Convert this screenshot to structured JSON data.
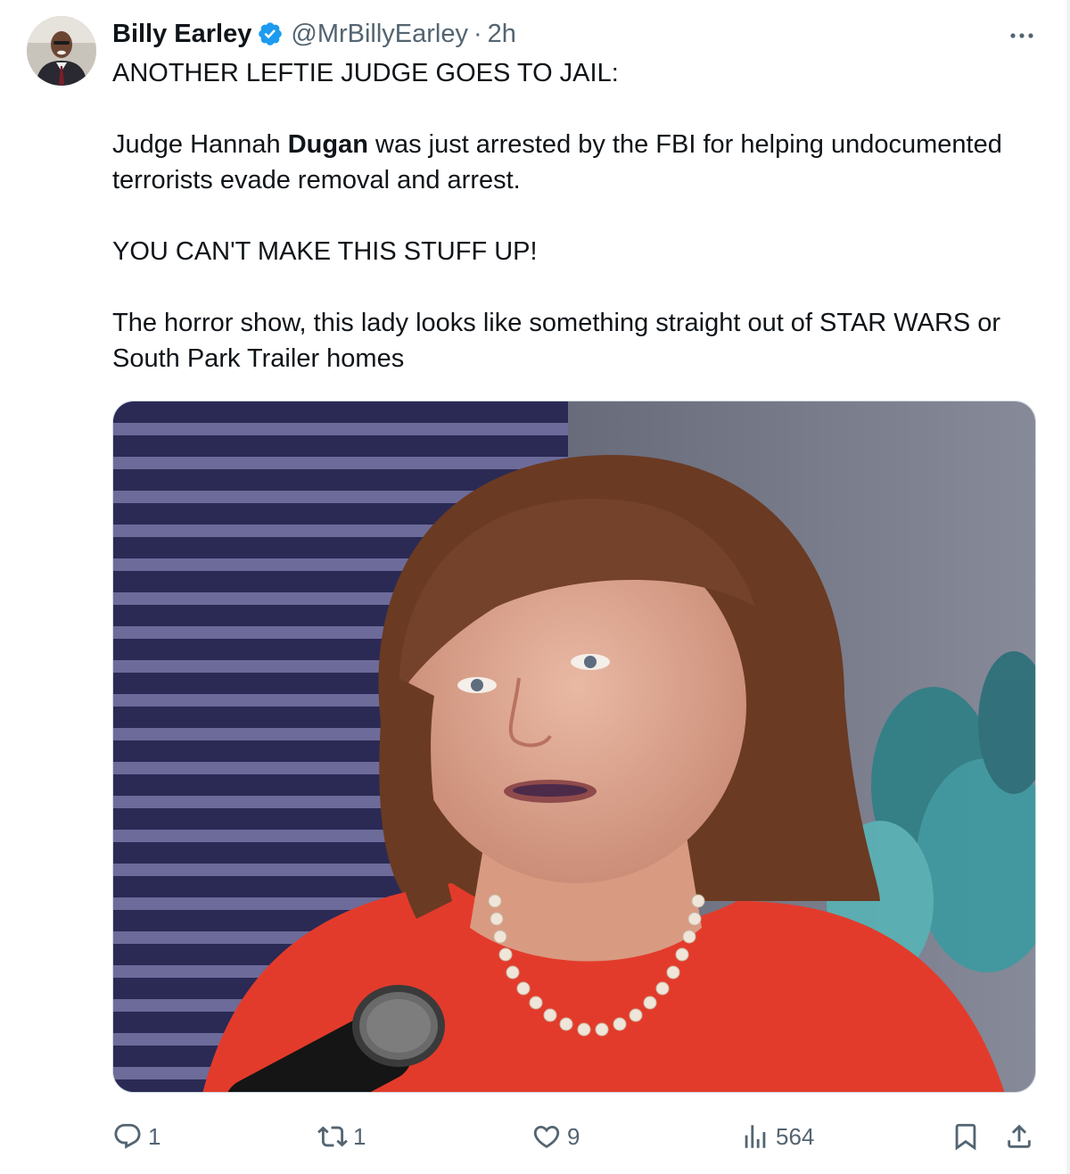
{
  "tweet": {
    "author_name": "Billy Earley",
    "handle": "@MrBillyEarley",
    "separator": "·",
    "time": "2h",
    "text": {
      "line1": "ANOTHER LEFTIE JUDGE GOES TO JAIL:",
      "p2_before": "Judge Hannah ",
      "p2_bold": "Dugan",
      "p2_after": " was just arrested by the FBI for helping undocumented terrorists evade removal and arrest.",
      "p3": "YOU CAN'T MAKE THIS STUFF UP!",
      "p4": "The horror show, this lady looks like something straight out of STAR WARS or South Park Trailer homes"
    }
  },
  "actions": {
    "replies": "1",
    "reposts": "1",
    "likes": "9",
    "views": "564"
  },
  "colors": {
    "text_primary": "#0f1419",
    "text_secondary": "#536471",
    "verified_blue": "#1d9bf0",
    "border": "#cfd9de"
  },
  "icons": [
    "verified-badge-icon",
    "more-icon",
    "reply-icon",
    "repost-icon",
    "like-icon",
    "views-icon",
    "bookmark-icon",
    "share-icon"
  ]
}
